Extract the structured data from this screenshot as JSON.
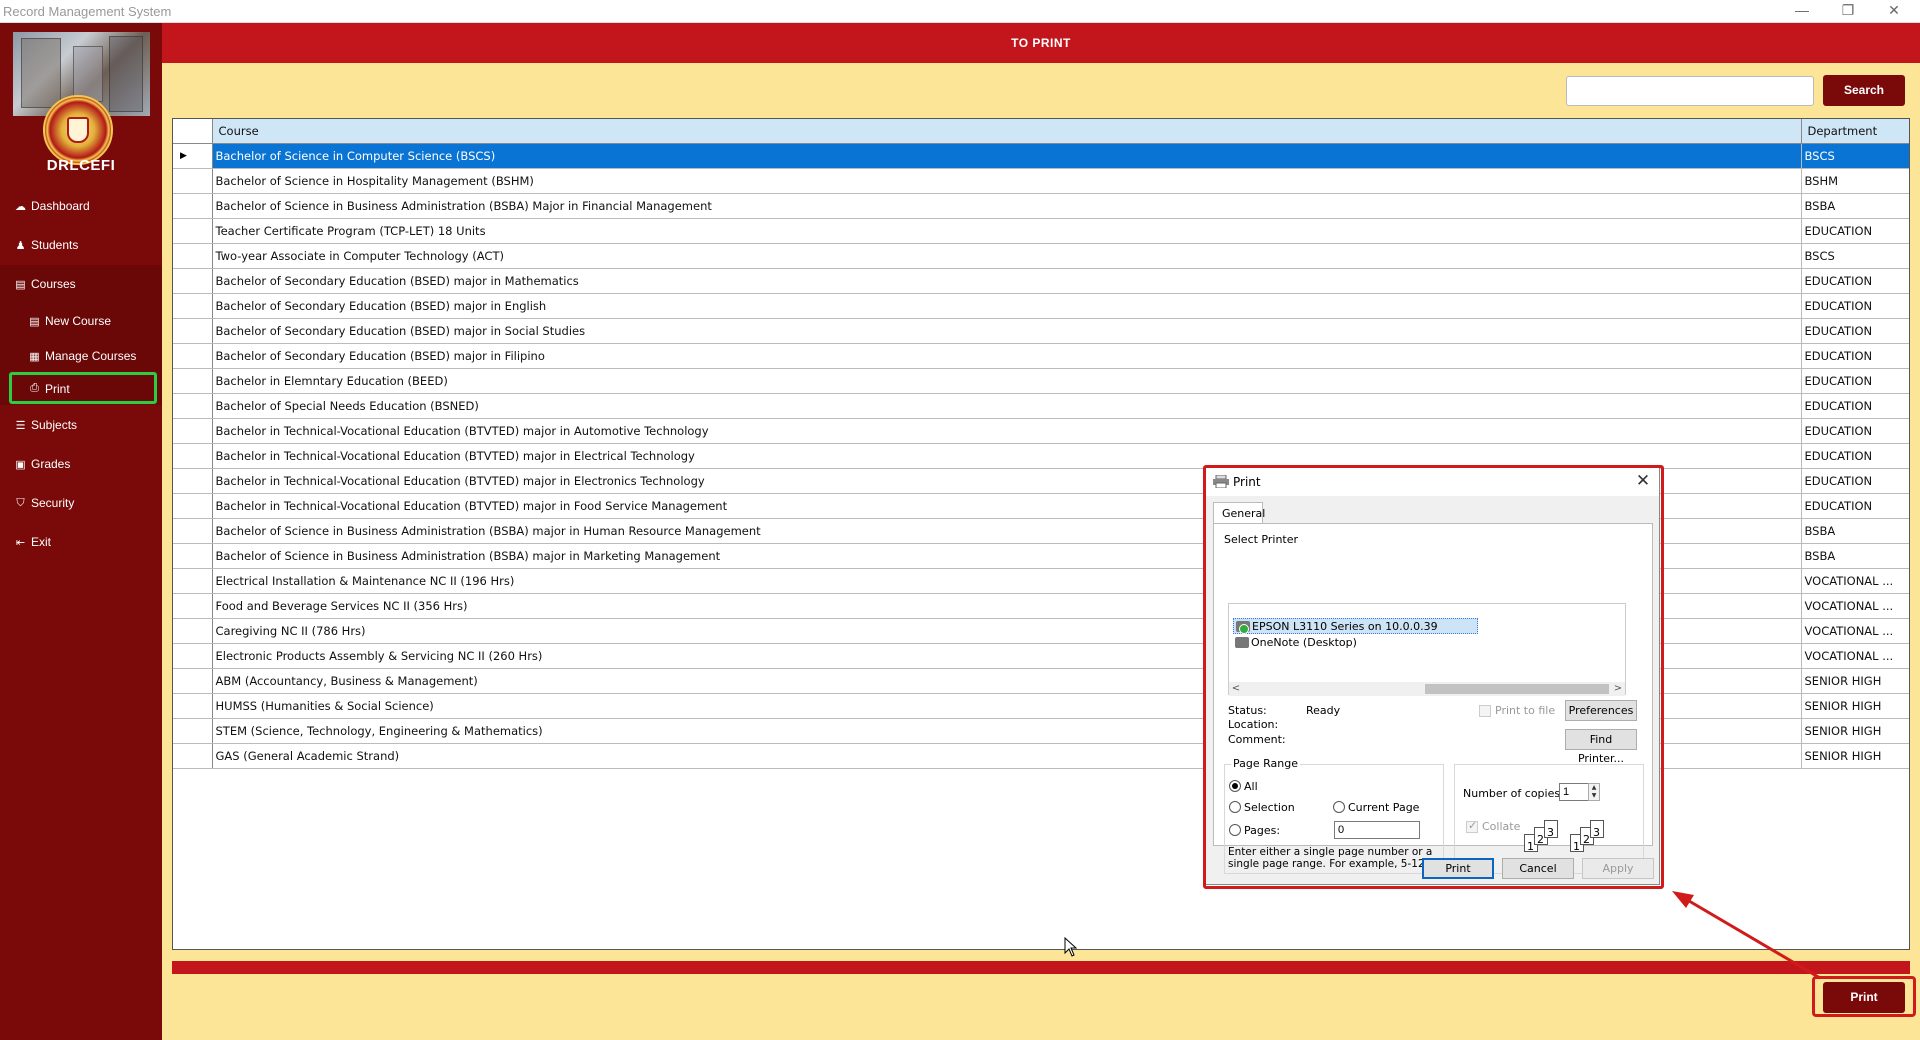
{
  "window": {
    "title": "Record Management System",
    "controls": {
      "minimize": "—",
      "restore": "❐",
      "close": "✕"
    }
  },
  "sidebar": {
    "brand": "DRLCEFI",
    "items": [
      {
        "label": "Dashboard",
        "icon": "dashboard-icon",
        "glyph": "☁"
      },
      {
        "label": "Students",
        "icon": "student-icon",
        "glyph": "♟"
      },
      {
        "label": "Courses",
        "icon": "courses-icon",
        "glyph": "▤"
      },
      {
        "label": "New  Course",
        "icon": "new-course-icon",
        "glyph": "▤"
      },
      {
        "label": "Manage Courses",
        "icon": "manage-courses-icon",
        "glyph": "▦"
      },
      {
        "label": "Print",
        "icon": "printer-icon",
        "glyph": "⎙"
      },
      {
        "label": "Subjects",
        "icon": "list-icon",
        "glyph": "☰"
      },
      {
        "label": "Grades",
        "icon": "grades-icon",
        "glyph": "▣"
      },
      {
        "label": "Security",
        "icon": "shield-icon",
        "glyph": "⛉"
      },
      {
        "label": "Exit",
        "icon": "exit-icon",
        "glyph": "⇤"
      }
    ]
  },
  "header": {
    "title": "TO PRINT"
  },
  "search": {
    "value": "",
    "button": "Search"
  },
  "table": {
    "columns": [
      "Course",
      "Department"
    ],
    "selected_marker": "▶",
    "rows": [
      [
        "Bachelor of Science in Computer Science (BSCS)",
        "BSCS"
      ],
      [
        "Bachelor of Science in Hospitality Management (BSHM)",
        "BSHM"
      ],
      [
        "Bachelor of Science in Business Administration (BSBA) Major in Financial Management",
        "BSBA"
      ],
      [
        "Teacher Certificate Program (TCP-LET) 18 Units",
        "EDUCATION"
      ],
      [
        "Two-year Associate in Computer Technology (ACT)",
        "BSCS"
      ],
      [
        "Bachelor of Secondary Education (BSED) major in Mathematics",
        "EDUCATION"
      ],
      [
        "Bachelor of Secondary Education (BSED) major in English",
        "EDUCATION"
      ],
      [
        "Bachelor of Secondary Education (BSED) major in Social Studies",
        "EDUCATION"
      ],
      [
        "Bachelor of Secondary Education (BSED) major in Filipino",
        "EDUCATION"
      ],
      [
        "Bachelor in Elemntary Education (BEED)",
        "EDUCATION"
      ],
      [
        "Bachelor of Special Needs Education (BSNED)",
        "EDUCATION"
      ],
      [
        "Bachelor in Technical-Vocational Education (BTVTED) major in Automotive Technology",
        "EDUCATION"
      ],
      [
        "Bachelor in Technical-Vocational Education (BTVTED) major in Electrical Technology",
        "EDUCATION"
      ],
      [
        "Bachelor in Technical-Vocational Education (BTVTED) major in Electronics Technology",
        "EDUCATION"
      ],
      [
        "Bachelor in Technical-Vocational Education (BTVTED) major in Food Service Management",
        "EDUCATION"
      ],
      [
        "Bachelor of Science in Business Administration (BSBA) major in Human Resource Management",
        "BSBA"
      ],
      [
        "Bachelor of Science in Business Administration (BSBA) major in Marketing Management",
        "BSBA"
      ],
      [
        "Electrical Installation & Maintenance NC II (196 Hrs)",
        "VOCATIONAL ..."
      ],
      [
        "Food and Beverage Services NC II (356 Hrs)",
        "VOCATIONAL ..."
      ],
      [
        "Caregiving NC II (786 Hrs)",
        "VOCATIONAL ..."
      ],
      [
        "Electronic Products Assembly & Servicing NC II (260 Hrs)",
        "VOCATIONAL ..."
      ],
      [
        "ABM (Accountancy, Business & Management)",
        "SENIOR HIGH"
      ],
      [
        "HUMSS (Humanities & Social Science)",
        "SENIOR HIGH"
      ],
      [
        "STEM (Science, Technology, Engineering & Mathematics)",
        "SENIOR HIGH"
      ],
      [
        "GAS (General Academic Strand)",
        "SENIOR HIGH"
      ]
    ]
  },
  "print_button": "Print",
  "dialog": {
    "title": "Print",
    "close": "✕",
    "tab": "General",
    "select_printer": "Select Printer",
    "printers": [
      "EPSON L3110 Series on 10.0.0.39",
      "OneNote (Desktop)"
    ],
    "scroll_left": "<",
    "scroll_right": ">",
    "status_label": "Status:",
    "status_value": "Ready",
    "location_label": "Location:",
    "comment_label": "Comment:",
    "print_to_file": "Print to file",
    "preferences": "Preferences",
    "find_printer": "Find Printer...",
    "page_range": "Page Range",
    "all": "All",
    "selection": "Selection",
    "current_page": "Current Page",
    "pages": "Pages:",
    "pages_value": "0",
    "hint": "Enter either a single page number or a single page range.  For example, 5-12",
    "copies_label": "Number of copies:",
    "copies_value": "1",
    "collate": "Collate",
    "page_glyphs": [
      "1",
      "2",
      "3"
    ],
    "buttons": {
      "print": "Print",
      "cancel": "Cancel",
      "apply": "Apply"
    }
  },
  "colors": {
    "sidebar": "#7a0a0a",
    "header": "#c3161c",
    "background": "#fce597",
    "highlight_green": "#2ecc40",
    "highlight_red": "#d11a1a",
    "row_selected": "#0a74d4"
  }
}
